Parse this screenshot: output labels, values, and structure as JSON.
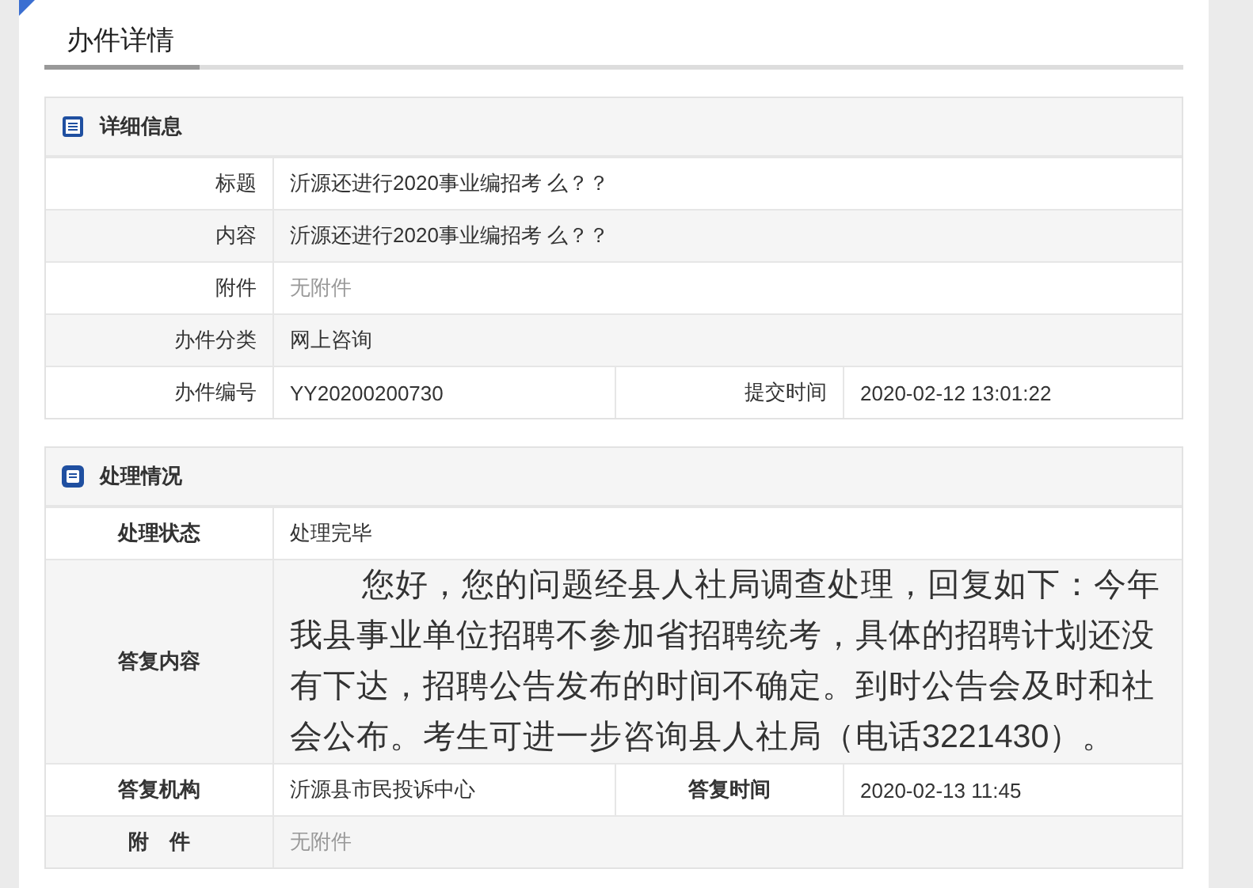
{
  "page_title": "办件详情",
  "sections": [
    {
      "title": "详细信息",
      "kind": "details",
      "rows": [
        {
          "pairs": [
            {
              "label": "标题",
              "value": "沂源还进行2020事业编招考 么？？",
              "dimmed": false
            }
          ]
        },
        {
          "pairs": [
            {
              "label": "内容",
              "value": "沂源还进行2020事业编招考 么？？",
              "dimmed": false
            }
          ]
        },
        {
          "pairs": [
            {
              "label": "附件",
              "value": "无附件",
              "dimmed": true
            }
          ]
        },
        {
          "pairs": [
            {
              "label": "办件分类",
              "value": "网上咨询",
              "dimmed": false
            }
          ]
        },
        {
          "pairs": [
            {
              "label": "办件编号",
              "value": "YY20200200730",
              "dimmed": false
            },
            {
              "label": "提交时间",
              "value": "2020-02-12 13:01:22",
              "dimmed": false
            }
          ]
        }
      ]
    },
    {
      "title": "处理情况",
      "kind": "handling",
      "rows": [
        {
          "pairs": [
            {
              "label": "处理状态",
              "value": "处理完毕",
              "dimmed": false
            }
          ]
        },
        {
          "kind": "answer",
          "pairs": [
            {
              "label": "答复内容",
              "value": "您好，您的问题经县人社局调查处理，回复如下：今年我县事业单位招聘不参加省招聘统考，具体的招聘计划还没有下达，招聘公告发布的时间不确定。到时公告会及时和社会公布。考生可进一步咨询县人社局（电话3221430）。",
              "dimmed": false
            }
          ]
        },
        {
          "pairs": [
            {
              "label": "答复机构",
              "value": "沂源县市民投诉中心",
              "dimmed": false
            },
            {
              "label": "答复时间",
              "value": "2020-02-13 11:45",
              "dimmed": false
            }
          ]
        },
        {
          "pairs": [
            {
              "label": "附　件",
              "value": "无附件",
              "dimmed": true
            }
          ]
        }
      ]
    }
  ]
}
